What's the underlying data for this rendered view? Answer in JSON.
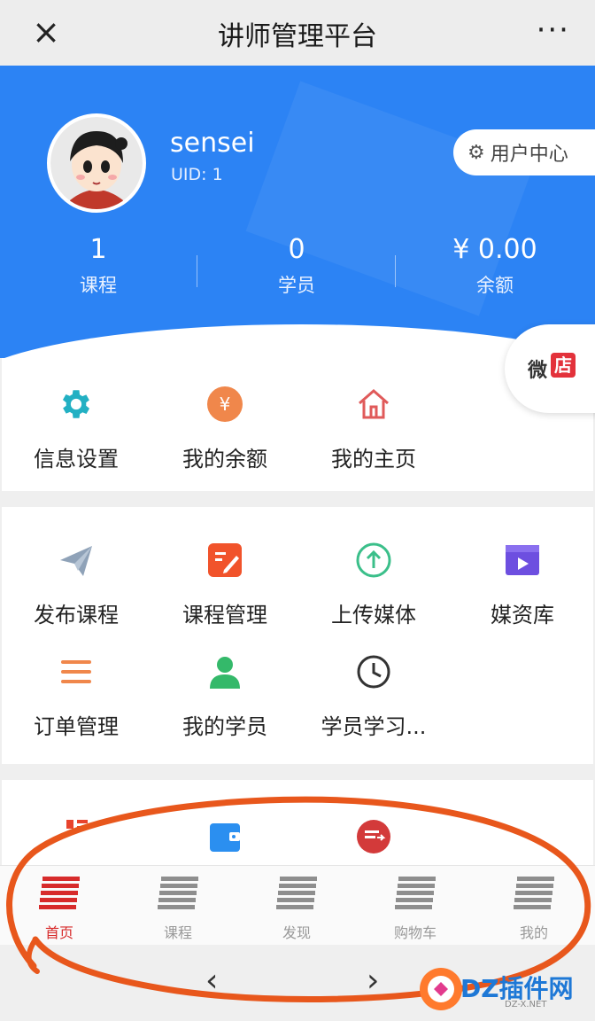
{
  "topbar": {
    "title": "讲师管理平台",
    "close_label": "×",
    "more_label": "···"
  },
  "profile": {
    "name": "sensei",
    "uid": "UID: 1",
    "user_center": "用户中心"
  },
  "stats": [
    {
      "value": "1",
      "label": "课程"
    },
    {
      "value": "0",
      "label": "学员"
    },
    {
      "value": "¥ 0.00",
      "label": "余额"
    }
  ],
  "weidian": {
    "c1": "微",
    "c2": "店"
  },
  "section1": [
    {
      "label": "信息设置",
      "icon": "gear-icon"
    },
    {
      "label": "我的余额",
      "icon": "yen-icon"
    },
    {
      "label": "我的主页",
      "icon": "home-icon"
    }
  ],
  "section2": [
    {
      "label": "发布课程",
      "icon": "paper-plane-icon"
    },
    {
      "label": "课程管理",
      "icon": "edit-icon"
    },
    {
      "label": "上传媒体",
      "icon": "upload-icon"
    },
    {
      "label": "媒资库",
      "icon": "video-icon"
    },
    {
      "label": "订单管理",
      "icon": "list-icon"
    },
    {
      "label": "我的学员",
      "icon": "user-icon"
    },
    {
      "label": "学员学习...",
      "icon": "clock-icon"
    }
  ],
  "tabs": [
    {
      "label": "首页",
      "active": true
    },
    {
      "label": "课程",
      "active": false
    },
    {
      "label": "发现",
      "active": false
    },
    {
      "label": "购物车",
      "active": false
    },
    {
      "label": "我的",
      "active": false
    }
  ],
  "nav": {
    "back": "‹",
    "forward": "›"
  },
  "watermark": {
    "text": "DZ插件网",
    "sub": "DZ-X.NET"
  },
  "colors": {
    "primary": "#2c83f4",
    "active_tab": "#d72b2b",
    "annotation": "#e8571c"
  }
}
